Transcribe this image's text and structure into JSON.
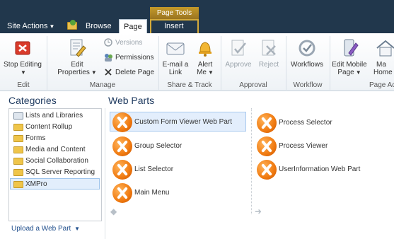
{
  "topbar": {
    "site_actions": "Site Actions",
    "tabs": [
      {
        "label": "Browse"
      },
      {
        "label": "Page"
      },
      {
        "label": "Insert"
      }
    ],
    "contextual_group": "Page Tools"
  },
  "ribbon": {
    "groups": [
      {
        "label": "Edit"
      },
      {
        "label": "Manage"
      },
      {
        "label": "Share & Track"
      },
      {
        "label": "Approval"
      },
      {
        "label": "Workflow"
      },
      {
        "label": "Page Ac"
      }
    ],
    "stop_editing": "Stop Editing",
    "edit_properties_1": "Edit",
    "edit_properties_2": "Properties",
    "versions": "Versions",
    "permissions": "Permissions",
    "delete_page": "Delete Page",
    "email_link_1": "E-mail a",
    "email_link_2": "Link",
    "alert_me_1": "Alert",
    "alert_me_2": "Me",
    "approve": "Approve",
    "reject": "Reject",
    "workflows": "Workflows",
    "edit_mobile_1": "Edit Mobile",
    "edit_mobile_2": "Page",
    "make_home_1": "Ma",
    "make_home_2": "Home"
  },
  "categories": {
    "title": "Categories",
    "items": [
      {
        "label": "Lists and Libraries"
      },
      {
        "label": "Content Rollup"
      },
      {
        "label": "Forms"
      },
      {
        "label": "Media and Content"
      },
      {
        "label": "Social Collaboration"
      },
      {
        "label": "SQL Server Reporting"
      },
      {
        "label": "XMPro"
      }
    ],
    "upload": "Upload a Web Part"
  },
  "webparts": {
    "title": "Web Parts",
    "col1": [
      {
        "label": "Custom Form Viewer Web Part"
      },
      {
        "label": "Group Selector"
      },
      {
        "label": "List Selector"
      },
      {
        "label": "Main Menu"
      }
    ],
    "col2": [
      {
        "label": "Process Selector"
      },
      {
        "label": "Process Viewer"
      },
      {
        "label": "UserInformation Web Part"
      }
    ]
  }
}
